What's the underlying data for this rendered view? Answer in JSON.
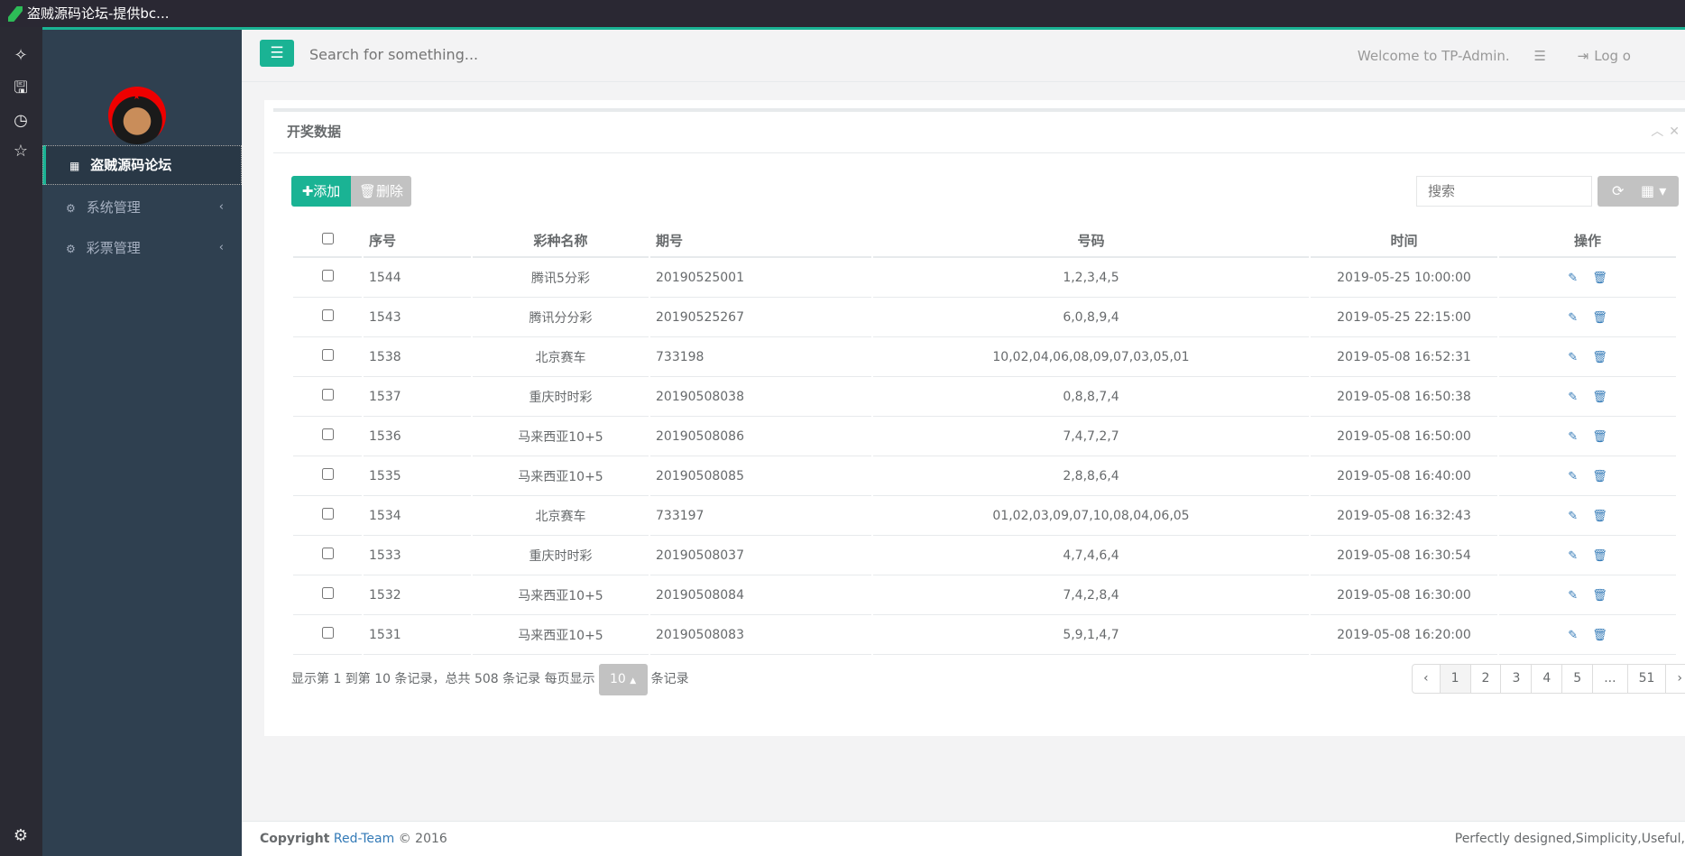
{
  "window": {
    "title": "盗贼源码论坛-提供bc..."
  },
  "strip_icons": [
    "sparkle-icon",
    "document-icon",
    "clock-icon",
    "star-icon",
    "gear-icon"
  ],
  "sidebar": {
    "items": [
      {
        "label": "盗贼源码论坛",
        "icon": "grid-icon",
        "active": true
      },
      {
        "label": "系统管理",
        "icon": "gear-icon"
      },
      {
        "label": "彩票管理",
        "icon": "gear-icon"
      }
    ]
  },
  "header": {
    "search_placeholder": "Search for something...",
    "welcome": "Welcome to TP-Admin.",
    "logout": "Log o"
  },
  "panel": {
    "title": "开奖数据",
    "add": "添加",
    "delete": "删除",
    "search_placeholder": "搜索"
  },
  "table": {
    "columns": [
      "序号",
      "彩种名称",
      "期号",
      "号码",
      "时间",
      "操作"
    ],
    "rows": [
      [
        "1544",
        "腾讯5分彩",
        "20190525001",
        "1,2,3,4,5",
        "2019-05-25 10:00:00"
      ],
      [
        "1543",
        "腾讯分分彩",
        "20190525267",
        "6,0,8,9,4",
        "2019-05-25 22:15:00"
      ],
      [
        "1538",
        "北京赛车",
        "733198",
        "10,02,04,06,08,09,07,03,05,01",
        "2019-05-08 16:52:31"
      ],
      [
        "1537",
        "重庆时时彩",
        "20190508038",
        "0,8,8,7,4",
        "2019-05-08 16:50:38"
      ],
      [
        "1536",
        "马来西亚10+5",
        "20190508086",
        "7,4,7,2,7",
        "2019-05-08 16:50:00"
      ],
      [
        "1535",
        "马来西亚10+5",
        "20190508085",
        "2,8,8,6,4",
        "2019-05-08 16:40:00"
      ],
      [
        "1534",
        "北京赛车",
        "733197",
        "01,02,03,09,07,10,08,04,06,05",
        "2019-05-08 16:32:43"
      ],
      [
        "1533",
        "重庆时时彩",
        "20190508037",
        "4,7,4,6,4",
        "2019-05-08 16:30:54"
      ],
      [
        "1532",
        "马来西亚10+5",
        "20190508084",
        "7,4,2,8,4",
        "2019-05-08 16:30:00"
      ],
      [
        "1531",
        "马来西亚10+5",
        "20190508083",
        "5,9,1,4,7",
        "2019-05-08 16:20:00"
      ]
    ]
  },
  "pagination": {
    "info_before": "显示第 1 到第 10 条记录，总共 508 条记录 每页显示",
    "page_size": "10",
    "info_after": "条记录",
    "pages": [
      "‹",
      "1",
      "2",
      "3",
      "4",
      "5",
      "...",
      "51",
      "›"
    ],
    "current": "1"
  },
  "footer": {
    "copyright": "Copyright",
    "team": "Red-Team",
    "year": "© 2016",
    "slogan": "Perfectly designed,Simplicity,Useful,"
  },
  "colors": {
    "accent": "#1ab394",
    "sidebar": "#2f4050",
    "link": "#337ab7"
  }
}
